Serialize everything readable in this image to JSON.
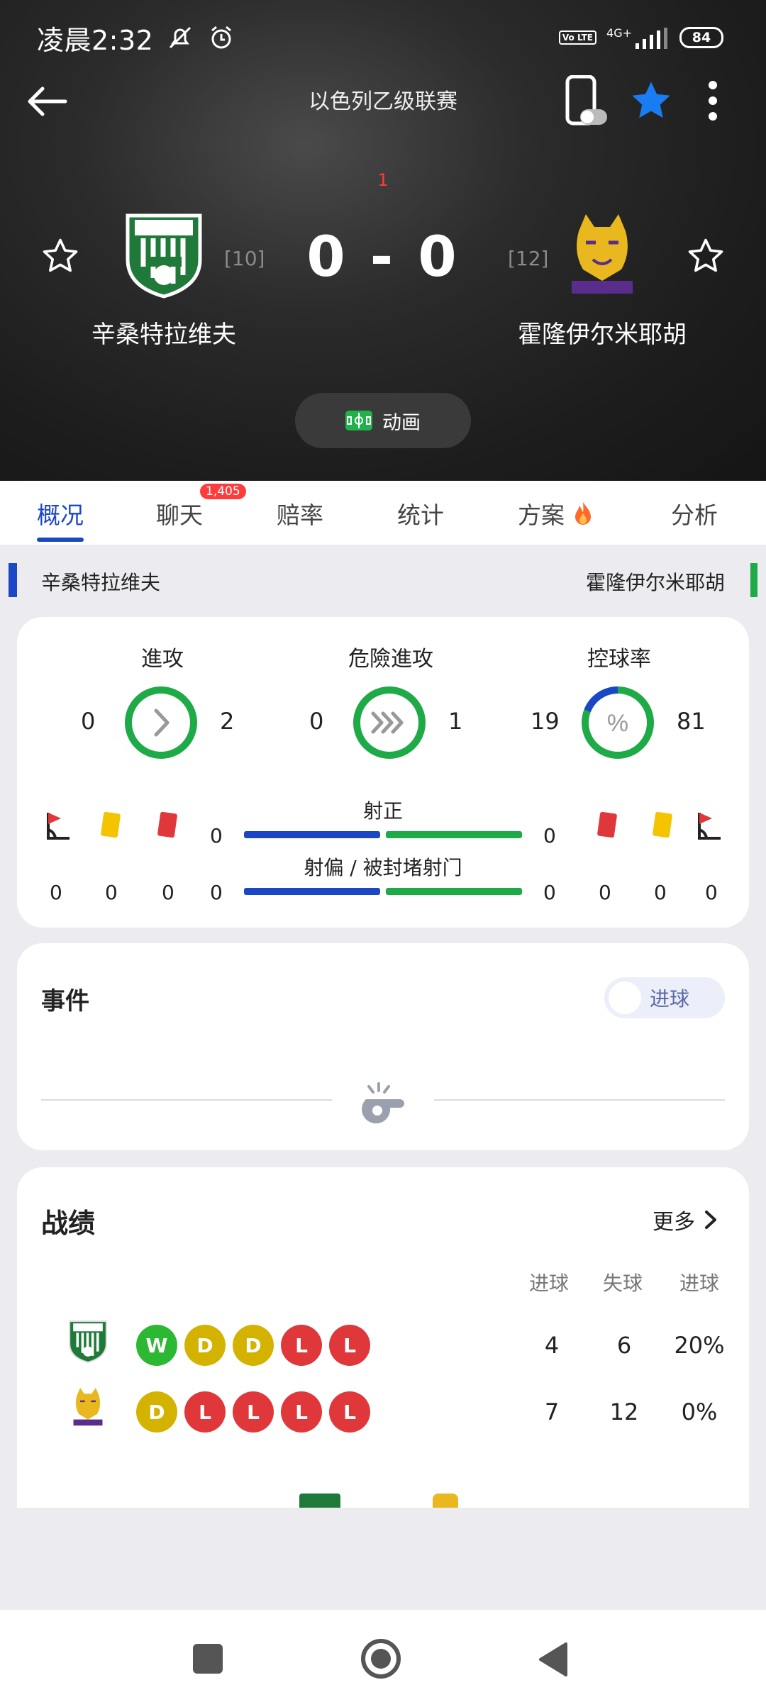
{
  "status": {
    "time": "凌晨2:32",
    "volte": "Vo LTE",
    "network": "4G+",
    "battery": "84"
  },
  "header": {
    "league": "以色列乙级联赛",
    "minute": "1",
    "score": "0 - 0",
    "home": {
      "name": "辛桑特拉维夫",
      "rank": "[10]"
    },
    "away": {
      "name": "霍隆伊尔米耶胡",
      "rank": "[12]"
    },
    "animation_label": "动画"
  },
  "tabs": [
    {
      "label": "概况",
      "active": true
    },
    {
      "label": "聊天",
      "badge": "1,405"
    },
    {
      "label": "赔率"
    },
    {
      "label": "统计"
    },
    {
      "label": "方案"
    },
    {
      "label": "分析"
    }
  ],
  "team_bar": {
    "home": "辛桑特拉维夫",
    "away": "霍隆伊尔米耶胡"
  },
  "stats": {
    "rings": [
      {
        "label": "進攻",
        "home": "0",
        "away": "2",
        "icon": "chevron-right-icon"
      },
      {
        "label": "危險進攻",
        "home": "0",
        "away": "1",
        "icon": "triple-chevron-icon"
      },
      {
        "label": "控球率",
        "home": "19",
        "away": "81",
        "icon": "percent-icon",
        "home_pct": 19
      }
    ],
    "shots_on_target": {
      "label": "射正",
      "home": "0",
      "away": "0"
    },
    "shots_off": {
      "label": "射偏 / 被封堵射门",
      "home": "0",
      "away": "0"
    },
    "home_cards": {
      "corners": "0",
      "yellow": "0",
      "red": "0"
    },
    "away_cards": {
      "red": "0",
      "yellow": "0",
      "corners": "0"
    }
  },
  "events": {
    "title": "事件",
    "toggle_label": "进球"
  },
  "record": {
    "title": "战绩",
    "more_label": "更多",
    "columns": [
      "进球",
      "失球",
      "进球"
    ],
    "rows": [
      {
        "form": [
          "W",
          "D",
          "D",
          "L",
          "L"
        ],
        "goals_for": "4",
        "goals_against": "6",
        "pct": "20%"
      },
      {
        "form": [
          "D",
          "L",
          "L",
          "L",
          "L"
        ],
        "goals_for": "7",
        "goals_against": "12",
        "pct": "0%"
      }
    ]
  },
  "colors": {
    "home": "#1b47c7",
    "away": "#1faa48",
    "win": "#2cb833",
    "draw": "#d4b300",
    "loss": "#e0383a"
  }
}
